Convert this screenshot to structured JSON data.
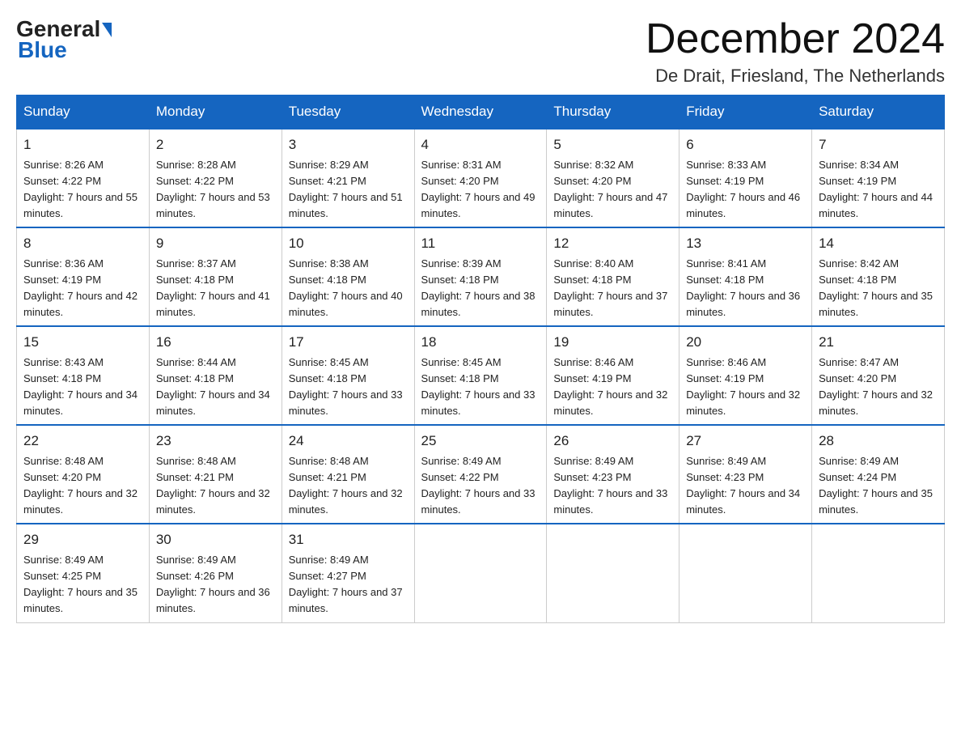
{
  "logo": {
    "general": "General",
    "blue": "Blue",
    "tagline": "Blue"
  },
  "header": {
    "month_title": "December 2024",
    "location": "De Drait, Friesland, The Netherlands"
  },
  "weekdays": [
    "Sunday",
    "Monday",
    "Tuesday",
    "Wednesday",
    "Thursday",
    "Friday",
    "Saturday"
  ],
  "weeks": [
    [
      {
        "day": "1",
        "sunrise": "8:26 AM",
        "sunset": "4:22 PM",
        "daylight": "7 hours and 55 minutes."
      },
      {
        "day": "2",
        "sunrise": "8:28 AM",
        "sunset": "4:22 PM",
        "daylight": "7 hours and 53 minutes."
      },
      {
        "day": "3",
        "sunrise": "8:29 AM",
        "sunset": "4:21 PM",
        "daylight": "7 hours and 51 minutes."
      },
      {
        "day": "4",
        "sunrise": "8:31 AM",
        "sunset": "4:20 PM",
        "daylight": "7 hours and 49 minutes."
      },
      {
        "day": "5",
        "sunrise": "8:32 AM",
        "sunset": "4:20 PM",
        "daylight": "7 hours and 47 minutes."
      },
      {
        "day": "6",
        "sunrise": "8:33 AM",
        "sunset": "4:19 PM",
        "daylight": "7 hours and 46 minutes."
      },
      {
        "day": "7",
        "sunrise": "8:34 AM",
        "sunset": "4:19 PM",
        "daylight": "7 hours and 44 minutes."
      }
    ],
    [
      {
        "day": "8",
        "sunrise": "8:36 AM",
        "sunset": "4:19 PM",
        "daylight": "7 hours and 42 minutes."
      },
      {
        "day": "9",
        "sunrise": "8:37 AM",
        "sunset": "4:18 PM",
        "daylight": "7 hours and 41 minutes."
      },
      {
        "day": "10",
        "sunrise": "8:38 AM",
        "sunset": "4:18 PM",
        "daylight": "7 hours and 40 minutes."
      },
      {
        "day": "11",
        "sunrise": "8:39 AM",
        "sunset": "4:18 PM",
        "daylight": "7 hours and 38 minutes."
      },
      {
        "day": "12",
        "sunrise": "8:40 AM",
        "sunset": "4:18 PM",
        "daylight": "7 hours and 37 minutes."
      },
      {
        "day": "13",
        "sunrise": "8:41 AM",
        "sunset": "4:18 PM",
        "daylight": "7 hours and 36 minutes."
      },
      {
        "day": "14",
        "sunrise": "8:42 AM",
        "sunset": "4:18 PM",
        "daylight": "7 hours and 35 minutes."
      }
    ],
    [
      {
        "day": "15",
        "sunrise": "8:43 AM",
        "sunset": "4:18 PM",
        "daylight": "7 hours and 34 minutes."
      },
      {
        "day": "16",
        "sunrise": "8:44 AM",
        "sunset": "4:18 PM",
        "daylight": "7 hours and 34 minutes."
      },
      {
        "day": "17",
        "sunrise": "8:45 AM",
        "sunset": "4:18 PM",
        "daylight": "7 hours and 33 minutes."
      },
      {
        "day": "18",
        "sunrise": "8:45 AM",
        "sunset": "4:18 PM",
        "daylight": "7 hours and 33 minutes."
      },
      {
        "day": "19",
        "sunrise": "8:46 AM",
        "sunset": "4:19 PM",
        "daylight": "7 hours and 32 minutes."
      },
      {
        "day": "20",
        "sunrise": "8:46 AM",
        "sunset": "4:19 PM",
        "daylight": "7 hours and 32 minutes."
      },
      {
        "day": "21",
        "sunrise": "8:47 AM",
        "sunset": "4:20 PM",
        "daylight": "7 hours and 32 minutes."
      }
    ],
    [
      {
        "day": "22",
        "sunrise": "8:48 AM",
        "sunset": "4:20 PM",
        "daylight": "7 hours and 32 minutes."
      },
      {
        "day": "23",
        "sunrise": "8:48 AM",
        "sunset": "4:21 PM",
        "daylight": "7 hours and 32 minutes."
      },
      {
        "day": "24",
        "sunrise": "8:48 AM",
        "sunset": "4:21 PM",
        "daylight": "7 hours and 32 minutes."
      },
      {
        "day": "25",
        "sunrise": "8:49 AM",
        "sunset": "4:22 PM",
        "daylight": "7 hours and 33 minutes."
      },
      {
        "day": "26",
        "sunrise": "8:49 AM",
        "sunset": "4:23 PM",
        "daylight": "7 hours and 33 minutes."
      },
      {
        "day": "27",
        "sunrise": "8:49 AM",
        "sunset": "4:23 PM",
        "daylight": "7 hours and 34 minutes."
      },
      {
        "day": "28",
        "sunrise": "8:49 AM",
        "sunset": "4:24 PM",
        "daylight": "7 hours and 35 minutes."
      }
    ],
    [
      {
        "day": "29",
        "sunrise": "8:49 AM",
        "sunset": "4:25 PM",
        "daylight": "7 hours and 35 minutes."
      },
      {
        "day": "30",
        "sunrise": "8:49 AM",
        "sunset": "4:26 PM",
        "daylight": "7 hours and 36 minutes."
      },
      {
        "day": "31",
        "sunrise": "8:49 AM",
        "sunset": "4:27 PM",
        "daylight": "7 hours and 37 minutes."
      },
      null,
      null,
      null,
      null
    ]
  ],
  "labels": {
    "sunrise_prefix": "Sunrise: ",
    "sunset_prefix": "Sunset: ",
    "daylight_prefix": "Daylight: "
  }
}
